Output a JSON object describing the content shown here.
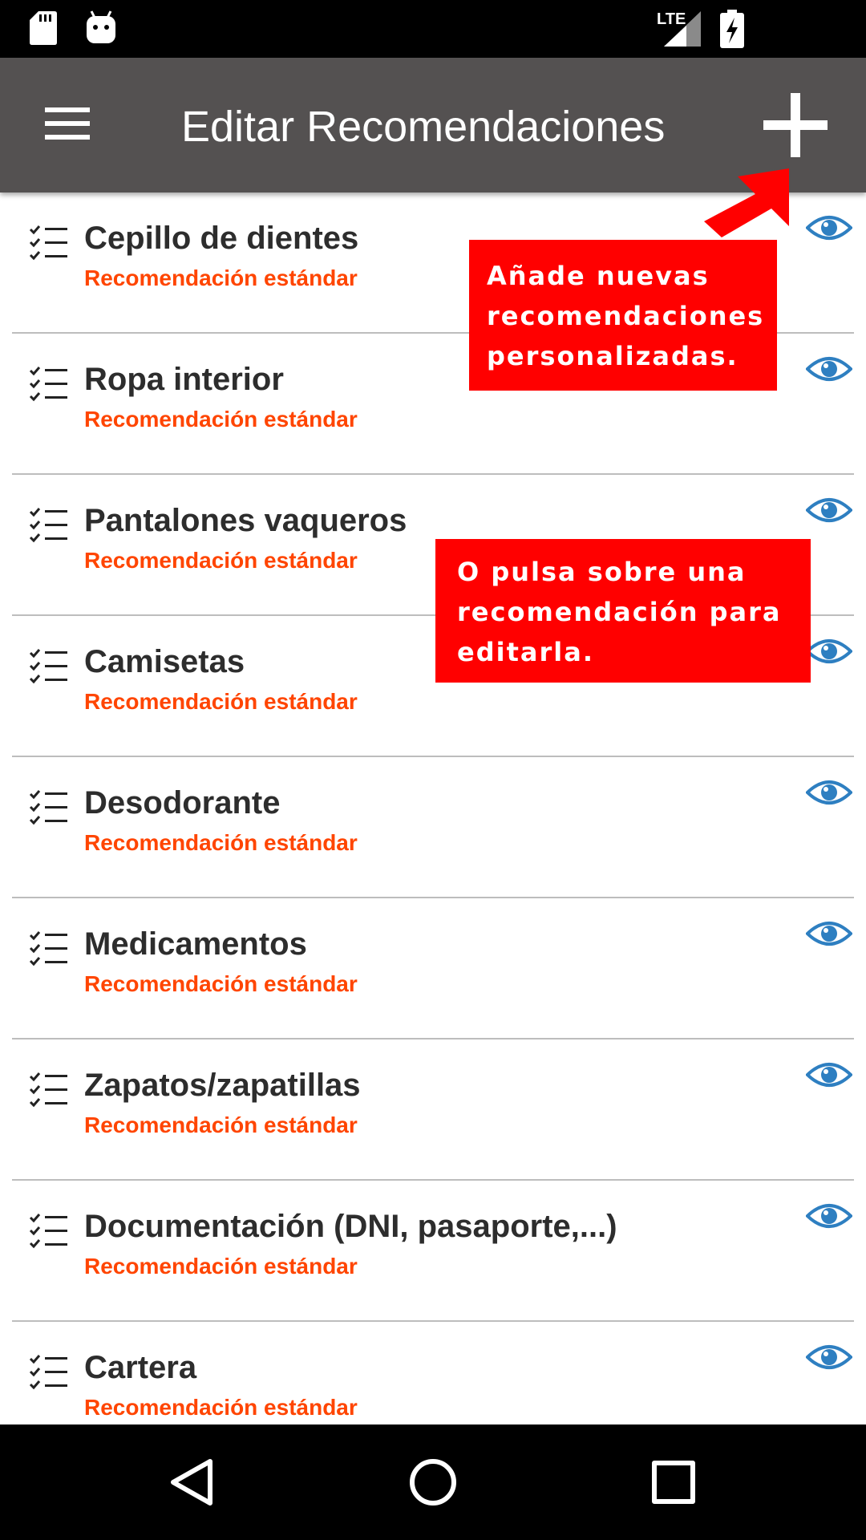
{
  "app_bar": {
    "title": "Editar Recomendaciones",
    "menu_icon": "hamburger-menu-icon",
    "add_icon": "plus-icon",
    "background": "#545151"
  },
  "status_bar": {
    "network": "LTE",
    "icons": [
      "sd-card-icon",
      "android-icon",
      "signal-icon",
      "battery-charging-icon"
    ]
  },
  "items": [
    {
      "name": "Cepillo de dientes",
      "subtitle": "Recomendación estándar"
    },
    {
      "name": "Ropa interior",
      "subtitle": "Recomendación estándar"
    },
    {
      "name": "Pantalones vaqueros",
      "subtitle": "Recomendación estándar"
    },
    {
      "name": "Camisetas",
      "subtitle": "Recomendación estándar"
    },
    {
      "name": "Desodorante",
      "subtitle": "Recomendación estándar"
    },
    {
      "name": "Medicamentos",
      "subtitle": "Recomendación estándar"
    },
    {
      "name": "Zapatos/zapatillas",
      "subtitle": "Recomendación estándar"
    },
    {
      "name": "Documentación (DNI, pasaporte,...)",
      "subtitle": "Recomendación estándar"
    },
    {
      "name": "Cartera",
      "subtitle": "Recomendación estándar"
    }
  ],
  "annotations": {
    "callout1": [
      "Añade nuevas",
      "recomendaciones",
      "personalizadas."
    ],
    "callout2": [
      "O pulsa sobre una",
      "recomendación para",
      "editarla."
    ]
  },
  "nav_bar": {
    "icons": [
      "back-triangle-icon",
      "home-circle-icon",
      "recents-square-icon"
    ]
  },
  "colors": {
    "subtitle": "#ff4500",
    "eye_icon": "#2e7fc1",
    "callout": "#ff0000",
    "app_bar": "#545151"
  }
}
